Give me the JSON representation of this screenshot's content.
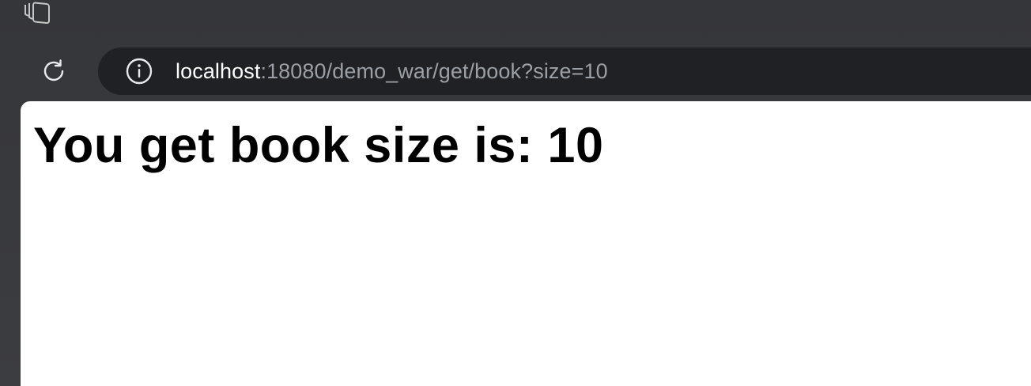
{
  "tabstrip": {
    "icon": "tab-groups-icon"
  },
  "toolbar": {
    "reload_icon": "reload-icon",
    "omnibox": {
      "info_icon": "info-icon",
      "url_host": "localhost",
      "url_rest": ":18080/demo_war/get/book?size=10"
    }
  },
  "page": {
    "heading": "You get book size is: 10"
  },
  "colors": {
    "frame": "#3a3b3f",
    "omnibox_bg": "#202124",
    "url_host": "#ffffff",
    "url_rest": "#9aa0a6",
    "page_bg": "#ffffff"
  }
}
